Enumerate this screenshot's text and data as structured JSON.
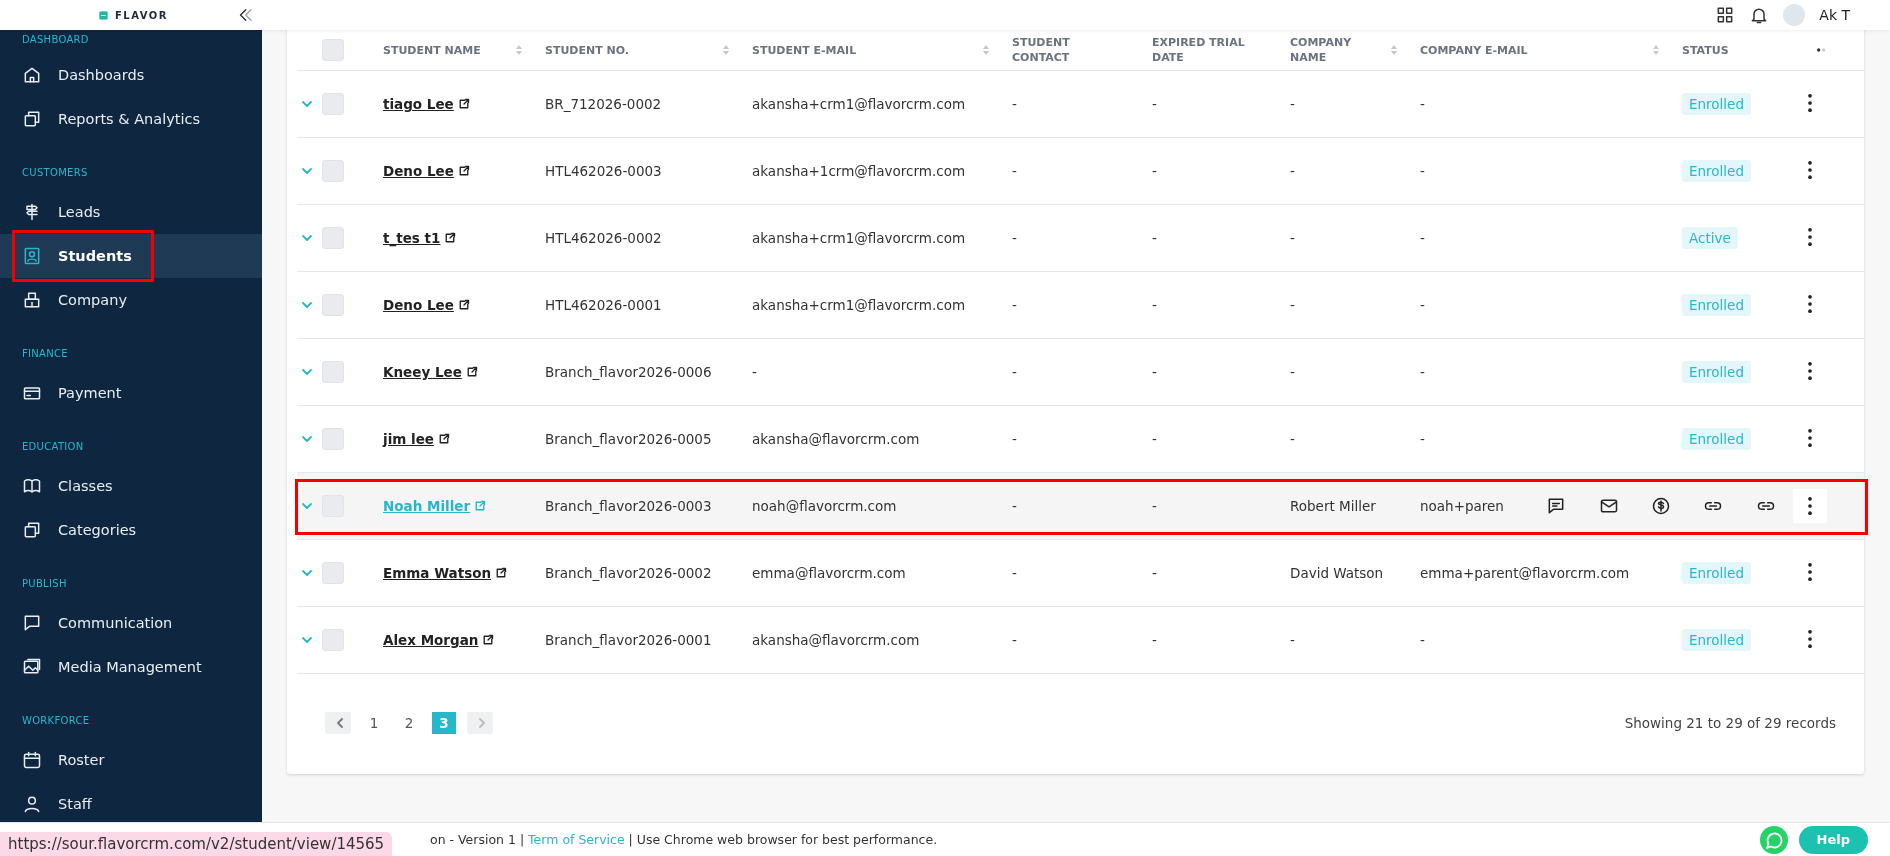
{
  "brand": {
    "logo_text": "FLAVOR"
  },
  "top_bar": {
    "user_name": "Ak T"
  },
  "sidebar": {
    "sections": [
      {
        "label": "DASHBOARD",
        "items": [
          {
            "label": "Dashboards",
            "kind": "home",
            "selected": false,
            "highlighted": false
          },
          {
            "label": "Reports & Analytics",
            "kind": "layers",
            "selected": false,
            "highlighted": false
          }
        ]
      },
      {
        "label": "CUSTOMERS",
        "items": [
          {
            "label": "Leads",
            "kind": "signpost",
            "selected": false,
            "highlighted": false
          },
          {
            "label": "Students",
            "kind": "person",
            "selected": true,
            "highlighted": true
          },
          {
            "label": "Company",
            "kind": "building",
            "selected": false,
            "highlighted": false
          }
        ]
      },
      {
        "label": "FINANCE",
        "items": [
          {
            "label": "Payment",
            "kind": "card",
            "selected": false,
            "highlighted": false
          }
        ]
      },
      {
        "label": "EDUCATION",
        "items": [
          {
            "label": "Classes",
            "kind": "book",
            "selected": false,
            "highlighted": false
          },
          {
            "label": "Categories",
            "kind": "layers",
            "selected": false,
            "highlighted": false
          }
        ]
      },
      {
        "label": "PUBLISH",
        "items": [
          {
            "label": "Communication",
            "kind": "chat",
            "selected": false,
            "highlighted": false
          },
          {
            "label": "Media Management",
            "kind": "image",
            "selected": false,
            "highlighted": false
          }
        ]
      },
      {
        "label": "WORKFORCE",
        "items": [
          {
            "label": "Roster",
            "kind": "calendar",
            "selected": false,
            "highlighted": false
          },
          {
            "label": "Staff",
            "kind": "user",
            "selected": false,
            "highlighted": false
          }
        ]
      }
    ]
  },
  "table": {
    "select_all_checked": false,
    "columns": [
      {
        "label": "STUDENT NAME",
        "sortable": true
      },
      {
        "label": "STUDENT NO.",
        "sortable": true
      },
      {
        "label": "STUDENT E-MAIL",
        "sortable": true
      },
      {
        "label": "STUDENT CONTACT",
        "sortable": false
      },
      {
        "label": "EXPIRED TRIAL DATE",
        "sortable": false
      },
      {
        "label": "COMPANY NAME",
        "sortable": true
      },
      {
        "label": "COMPANY E-MAIL",
        "sortable": true
      },
      {
        "label": "STATUS",
        "sortable": false
      }
    ],
    "rows": [
      {
        "name": "tiago Lee",
        "student_no": "BR_712026-0002",
        "email": "akansha+crm1@flavorcrm.com",
        "contact": "-",
        "expired_trial_date": "-",
        "company_name": "-",
        "company_email": "-",
        "status": "Enrolled",
        "checked": false,
        "hovered": false,
        "highlighted": false
      },
      {
        "name": "Deno Lee",
        "student_no": "HTL462026-0003",
        "email": "akansha+1crm@flavorcrm.com",
        "contact": "-",
        "expired_trial_date": "-",
        "company_name": "-",
        "company_email": "-",
        "status": "Enrolled",
        "checked": false,
        "hovered": false,
        "highlighted": false
      },
      {
        "name": "t_tes t1",
        "student_no": "HTL462026-0002",
        "email": "akansha+crm1@flavorcrm.com",
        "contact": "-",
        "expired_trial_date": "-",
        "company_name": "-",
        "company_email": "-",
        "status": "Active",
        "checked": false,
        "hovered": false,
        "highlighted": false
      },
      {
        "name": "Deno Lee",
        "student_no": "HTL462026-0001",
        "email": "akansha+crm1@flavorcrm.com",
        "contact": "-",
        "expired_trial_date": "-",
        "company_name": "-",
        "company_email": "-",
        "status": "Enrolled",
        "checked": false,
        "hovered": false,
        "highlighted": false
      },
      {
        "name": "Kneey Lee",
        "student_no": "Branch_flavor2026-0006",
        "email": "-",
        "contact": "-",
        "expired_trial_date": "-",
        "company_name": "-",
        "company_email": "-",
        "status": "Enrolled",
        "checked": false,
        "hovered": false,
        "highlighted": false
      },
      {
        "name": "jim lee",
        "student_no": "Branch_flavor2026-0005",
        "email": "akansha@flavorcrm.com",
        "contact": "-",
        "expired_trial_date": "-",
        "company_name": "-",
        "company_email": "-",
        "status": "Enrolled",
        "checked": false,
        "hovered": false,
        "highlighted": false
      },
      {
        "name": "Noah Miller",
        "student_no": "Branch_flavor2026-0003",
        "email": "noah@flavorcrm.com",
        "contact": "-",
        "expired_trial_date": "-",
        "company_name": "Robert Miller",
        "company_email": "noah+paren",
        "checked": false,
        "hovered": true,
        "highlighted": true
      },
      {
        "name": "Emma Watson",
        "student_no": "Branch_flavor2026-0002",
        "email": "emma@flavorcrm.com",
        "contact": "-",
        "expired_trial_date": "-",
        "company_name": "David Watson",
        "company_email": "emma+parent@flavorcrm.com",
        "status": "Enrolled",
        "checked": false,
        "hovered": false,
        "highlighted": false
      },
      {
        "name": "Alex Morgan",
        "student_no": "Branch_flavor2026-0001",
        "email": "akansha@flavorcrm.com",
        "contact": "-",
        "expired_trial_date": "-",
        "company_name": "-",
        "company_email": "-",
        "status": "Enrolled",
        "checked": false,
        "hovered": false,
        "highlighted": false
      }
    ]
  },
  "pagination": {
    "pages": [
      {
        "label": "1",
        "selected": false
      },
      {
        "label": "2",
        "selected": false
      },
      {
        "label": "3",
        "selected": true
      }
    ],
    "records_text": "Showing 21 to 29 of 29 records"
  },
  "footer": {
    "text_before": "on - Version 1 |",
    "link": "Term of Service",
    "text_after": "| Use Chrome web browser for best performance."
  },
  "status_url": "https://sour.flavorcrm.com/v2/student/view/14565",
  "help_button": "Help"
}
